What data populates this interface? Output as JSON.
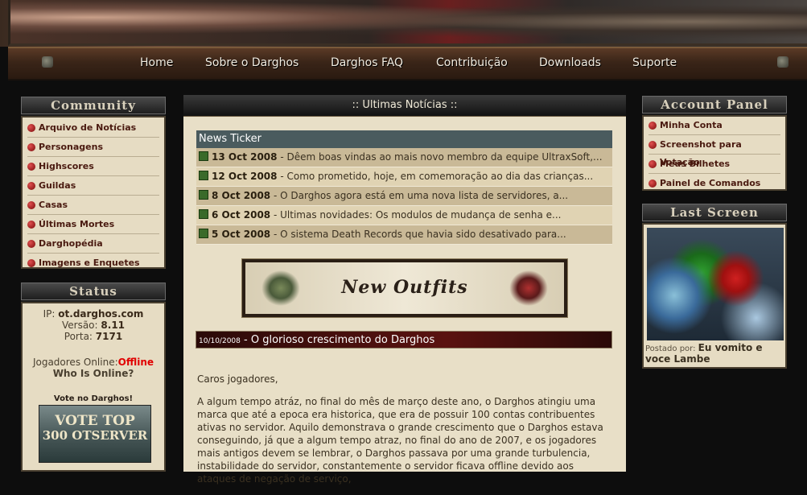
{
  "nav": {
    "items": [
      "Home",
      "Sobre o Darghos",
      "Darghos FAQ",
      "Contribuição",
      "Downloads",
      "Suporte"
    ]
  },
  "community": {
    "title": "Community",
    "items": [
      "Arquivo de Notícias",
      "Personagens",
      "Highscores",
      "Guildas",
      "Casas",
      "Últimas Mortes",
      "Darghopédia",
      "Imagens e Enquetes"
    ]
  },
  "status": {
    "title": "Status",
    "ip_label": "IP:",
    "ip_value": "ot.darghos.com",
    "version_label": "Versão:",
    "version_value": "8.11",
    "port_label": "Porta:",
    "port_value": "7171",
    "players_label": "Jogadores Online:",
    "players_value": "Offline",
    "who_online": "Who Is Online?",
    "vote_label": "Vote no Darghos!",
    "vote_banner_line1": "VOTE TOP",
    "vote_banner_line2": "300 OTSERVER"
  },
  "main": {
    "header": ":: Ultimas Notícias ::",
    "ticker_title": "News Ticker",
    "ticker": [
      {
        "date": "13 Oct 2008",
        "text": "- Dêem boas vindas ao mais novo membro da equipe UltraxSoft,..."
      },
      {
        "date": "12 Oct 2008",
        "text": "- Como prometido, hoje, em comemoração ao dia das crianças..."
      },
      {
        "date": "8 Oct 2008",
        "text": "- O Darghos agora está em uma nova lista de servidores, a..."
      },
      {
        "date": "6 Oct 2008",
        "text": "- Ultimas novidades: Os modulos de mudança de senha e..."
      },
      {
        "date": "5 Oct 2008",
        "text": "- O sistema Death Records que havia sido desativado para..."
      }
    ],
    "outfits_banner": "New Outfits",
    "news_date": "10/10/2008",
    "news_title": "- O glorioso crescimento do Darghos",
    "news_greeting": "Caros jogadores,",
    "news_paragraph": "A algum tempo atráz, no final do mês de março deste ano, o Darghos atingiu uma marca que até a epoca era historica, que era de possuir 100 contas contribuentes ativas no servidor. Aquilo demonstrava o grande crescimento que o Darghos estava conseguindo, já que a algum tempo atraz, no final do ano de 2007, e os jogadores mais antigos devem se lembrar, o Darghos passava por uma grande turbulencia, instabilidade do servidor, constantemente o servidor ficava offline devido aos ataques de negação de serviço,"
  },
  "account_panel": {
    "title": "Account Panel",
    "items": [
      "Minha Conta",
      "Screenshot para Votação",
      "Meus Bilhetes",
      "Painel de Comandos"
    ]
  },
  "last_screen": {
    "title": "Last Screen",
    "posted_label": "Postado por:",
    "posted_by": "Eu vomito e voce Lambe"
  }
}
